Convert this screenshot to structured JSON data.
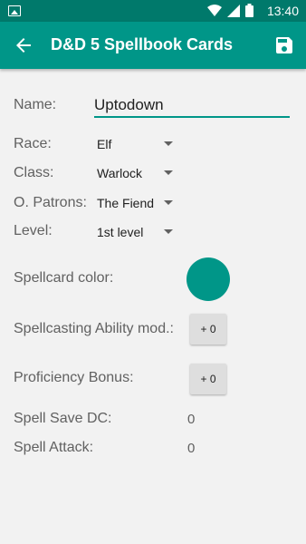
{
  "status_bar": {
    "time": "13:40"
  },
  "app_bar": {
    "title": "D&D 5 Spellbook Cards"
  },
  "form": {
    "name_label": "Name:",
    "name_value": "Uptodown",
    "race_label": "Race:",
    "race_value": "Elf",
    "class_label": "Class:",
    "class_value": "Warlock",
    "patrons_label": "O. Patrons:",
    "patrons_value": "The Fiend",
    "level_label": "Level:",
    "level_value": "1st level",
    "color_label": "Spellcard color:",
    "card_color": "#009688",
    "ability_label": "Spellcasting Ability mod.:",
    "ability_value": "+ 0",
    "proficiency_label": "Proficiency Bonus:",
    "proficiency_value": "+ 0",
    "save_dc_label": "Spell Save DC:",
    "save_dc_value": "0",
    "attack_label": "Spell Attack:",
    "attack_value": "0"
  },
  "colors": {
    "primary": "#009688",
    "primary_dark": "#00796b"
  }
}
